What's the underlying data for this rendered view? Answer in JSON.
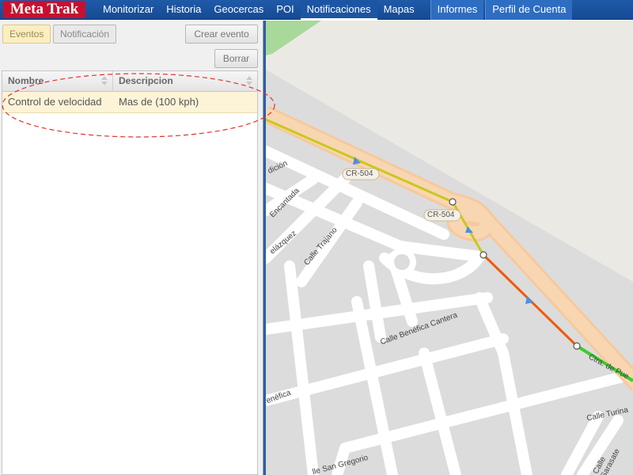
{
  "header": {
    "logo": "Meta Trak",
    "nav": [
      {
        "label": "Monitorizar"
      },
      {
        "label": "Historia"
      },
      {
        "label": "Geocercas"
      },
      {
        "label": "POI"
      },
      {
        "label": "Notificaciones",
        "active": true
      },
      {
        "label": "Mapas"
      },
      {
        "label": "Informes"
      },
      {
        "label": "Perfil de Cuenta"
      }
    ]
  },
  "left_panel": {
    "tabs": [
      {
        "label": "Eventos",
        "selected": true
      },
      {
        "label": "Notificación",
        "selected": false
      }
    ],
    "create_button": "Crear evento",
    "delete_button": "Borrar",
    "grid": {
      "columns": [
        "Nombre",
        "Descripcion"
      ],
      "rows": [
        {
          "nombre": "Control de velocidad",
          "descripcion": "Mas de (100 kph)"
        }
      ]
    }
  },
  "map": {
    "road_labels": {
      "cr504_a": "CR-504",
      "cr504_b": "CR-504",
      "dicion": "dición",
      "encantada": "Encantada",
      "velazquez": "elázquez",
      "trajano": "Calle Trajano",
      "benefica_cantera": "Calle Benéfica Cantera",
      "benefica": "enéfica",
      "ctra_puerto": "Ctra. de Pue",
      "turina": "Calle Turina",
      "sarasate": "Calle Sarasate",
      "san_gregorio": "lle San Gregorio"
    }
  },
  "colors": {
    "nav_bar": "#1f5aa8",
    "logo_bg": "#c8102e",
    "selected_row": "#fdf4d8",
    "route_yellow": "#c8c81e",
    "route_orange": "#f05a0a",
    "route_green": "#3ccc2a",
    "highlight_ellipse": "#e8302a"
  }
}
